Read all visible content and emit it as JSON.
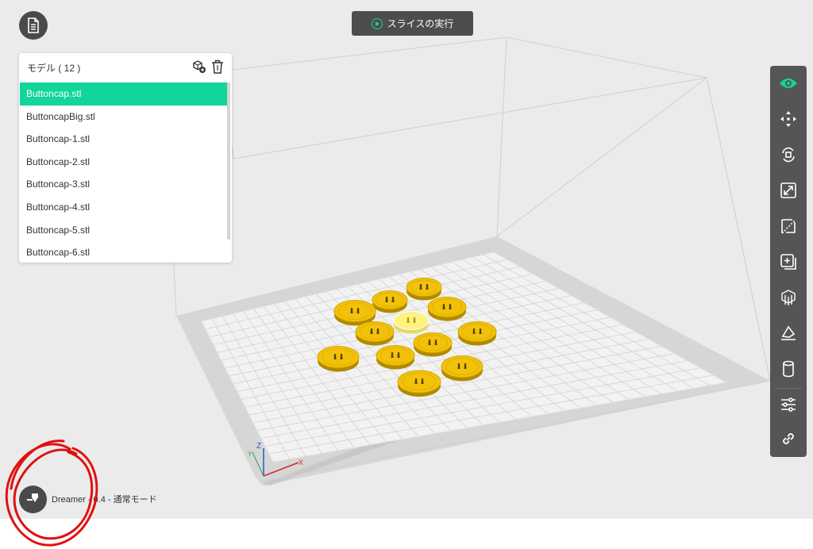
{
  "toolbar_top": {
    "file_icon": "document-icon",
    "slice_button_label": "スライスの実行"
  },
  "model_panel": {
    "title": "モデル ( 12 )",
    "items": [
      "Buttoncap.stl",
      "ButtoncapBig.stl",
      "Buttoncap-1.stl",
      "Buttoncap-2.stl",
      "Buttoncap-3.stl",
      "Buttoncap-4.stl",
      "Buttoncap-5.stl",
      "Buttoncap-6.stl"
    ],
    "selected_index": 0
  },
  "right_toolbar": {
    "tools": [
      "eye-icon",
      "move-icon",
      "rotate-icon",
      "scale-icon",
      "mirror-icon",
      "add-model-icon",
      "support-icon",
      "lay-flat-icon",
      "cylinder-icon",
      "settings-sliders-icon",
      "link-icon"
    ]
  },
  "printer": {
    "label": "Dreamer - 0.4 - 通常モード"
  },
  "axes": {
    "x": "X",
    "y": "Y",
    "z": "Z"
  },
  "colors": {
    "accent": "#11d59a",
    "part": "#f2c20a",
    "part_selected": "#fff47a",
    "toolbar_bg": "#555555",
    "annotation": "#e01010"
  }
}
